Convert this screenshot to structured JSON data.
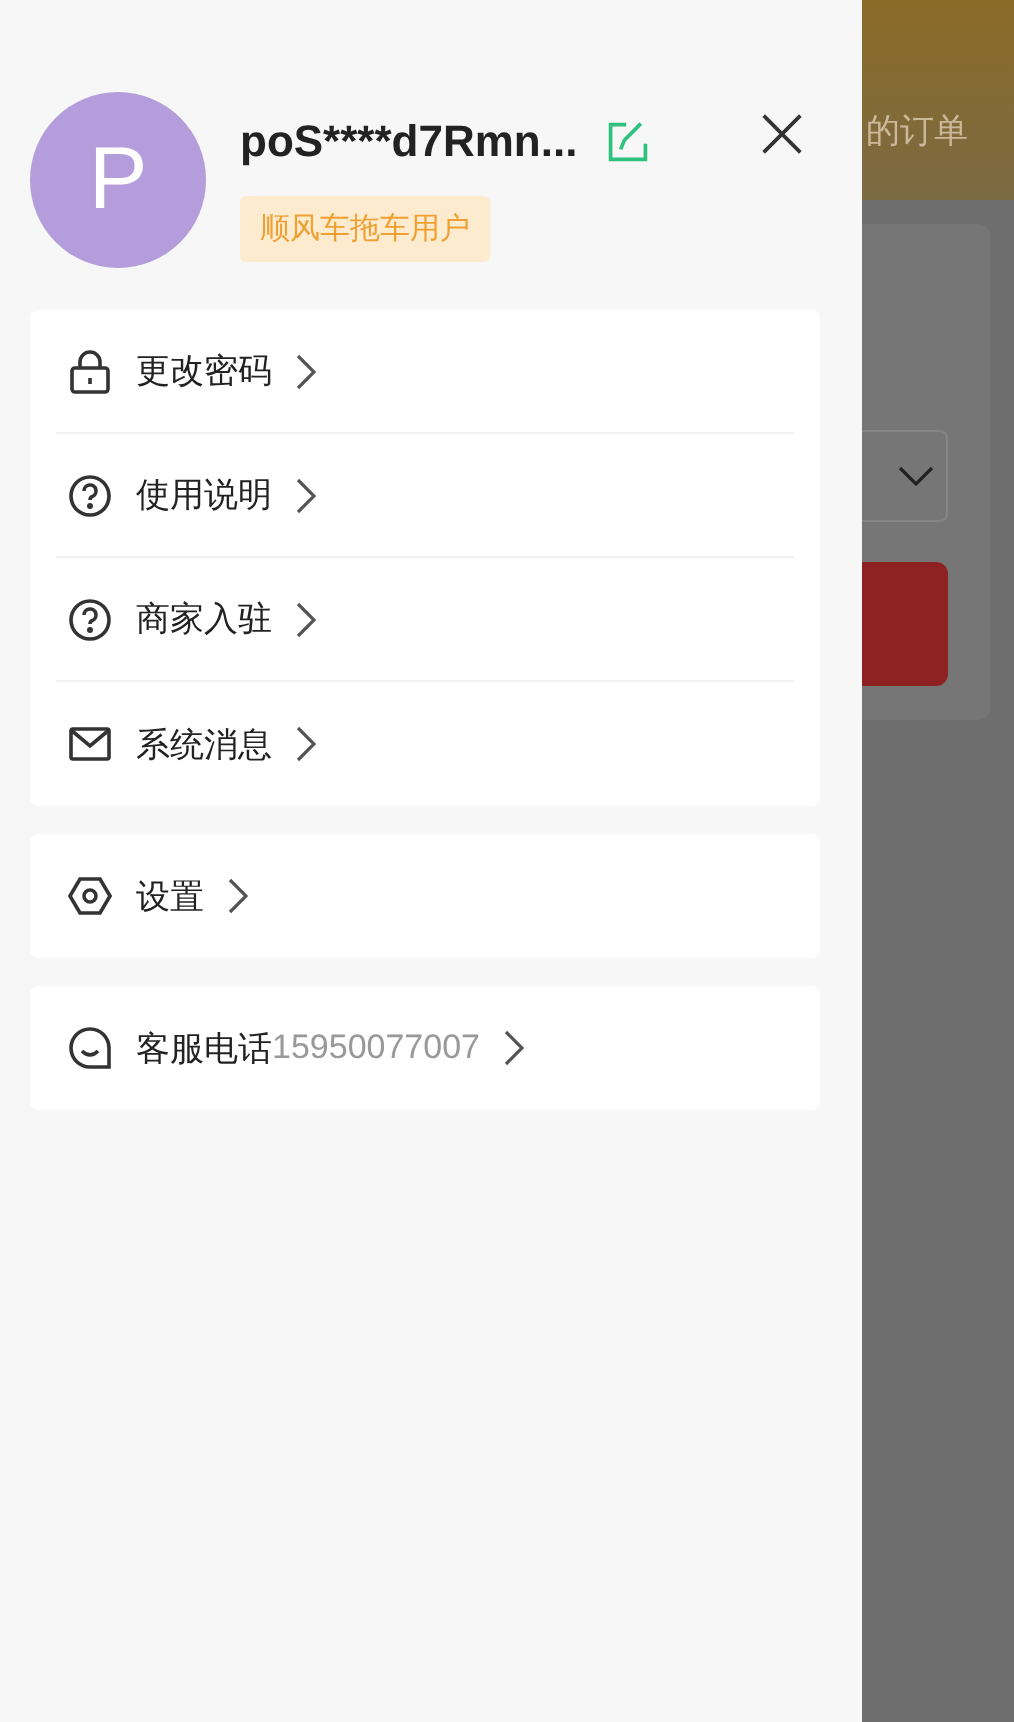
{
  "profile": {
    "avatar_letter": "P",
    "username": "poS****d7Rmn...",
    "tag": "顺风车拖车用户"
  },
  "menu_groups": [
    {
      "items": [
        {
          "kind": "lock",
          "label": "更改密码"
        },
        {
          "kind": "help",
          "label": "使用说明"
        },
        {
          "kind": "help",
          "label": "商家入驻"
        },
        {
          "kind": "mail",
          "label": "系统消息"
        }
      ]
    },
    {
      "items": [
        {
          "kind": "settings",
          "label": "设置"
        }
      ]
    },
    {
      "items": [
        {
          "kind": "chat",
          "label": "客服电话",
          "value": "15950077007"
        }
      ]
    }
  ],
  "background_page": {
    "header_text": "的订单"
  }
}
